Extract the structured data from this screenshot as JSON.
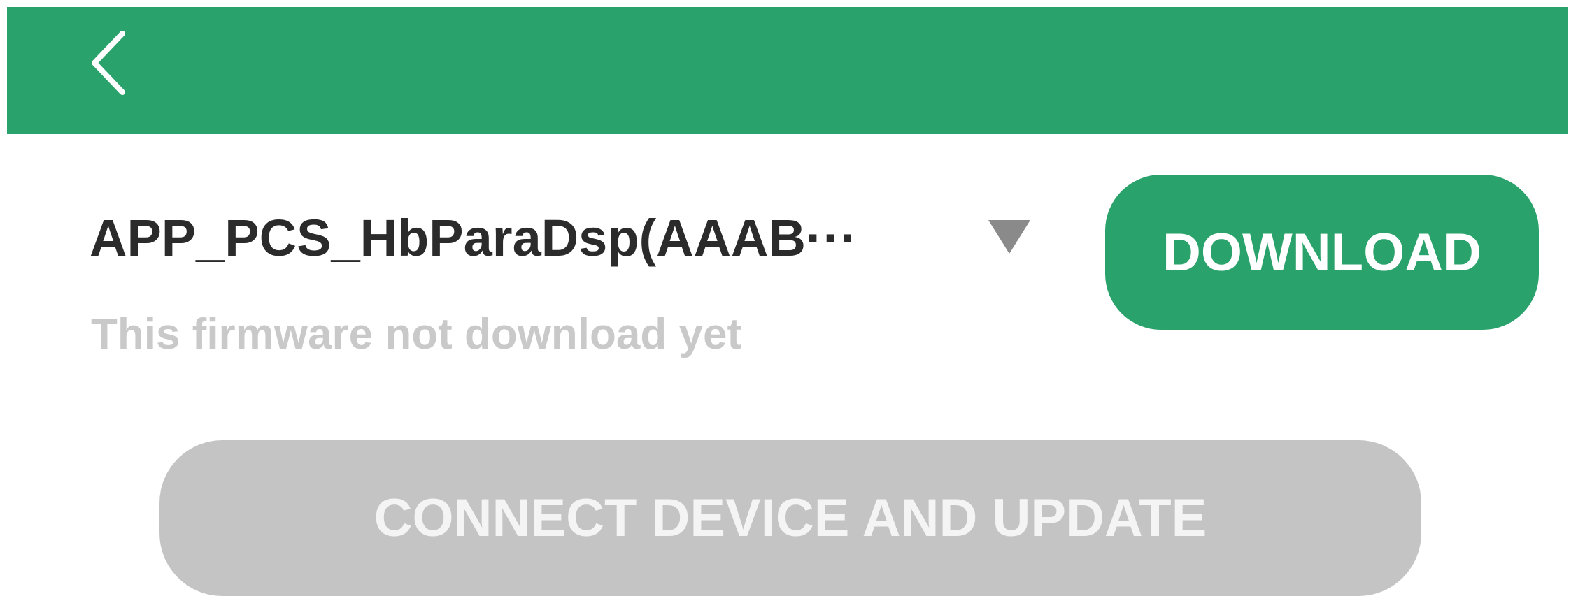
{
  "header": {
    "back_icon": "chevron-left-icon",
    "color": "#2aa26b"
  },
  "firmware": {
    "selected": "APP_PCS_HbParaDsp(AAAB···",
    "dropdown_icon": "caret-down-icon",
    "status": "This firmware not download yet"
  },
  "actions": {
    "download_label": "DOWNLOAD",
    "update_label": "CONNECT DEVICE AND UPDATE",
    "accent_color": "#2aa26b",
    "disabled_color": "#c4c4c4"
  }
}
